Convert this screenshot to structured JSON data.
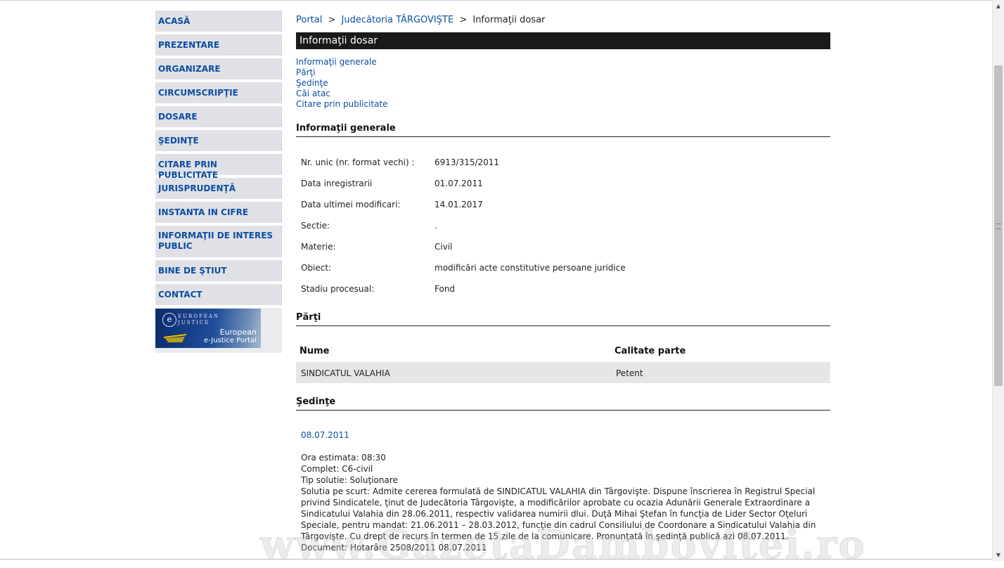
{
  "sidebar": {
    "items": [
      {
        "label": "ACASĂ"
      },
      {
        "label": "PREZENTARE"
      },
      {
        "label": "ORGANIZARE"
      },
      {
        "label": "CIRCUMSCRIPŢIE"
      },
      {
        "label": "DOSARE"
      },
      {
        "label": "ŞEDINŢE"
      },
      {
        "label": "CITARE PRIN PUBLICITATE"
      },
      {
        "label": "JURISPRUDENŢĂ"
      },
      {
        "label": "INSTANTA IN CIFRE"
      },
      {
        "label": "INFORMAŢII DE INTERES PUBLIC"
      },
      {
        "label": "BINE DE ŞTIUT"
      },
      {
        "label": "CONTACT"
      }
    ],
    "banner": {
      "logo_letter": "e",
      "line1": "EUROPEAN",
      "line2": "JUSTICE",
      "title1": "European",
      "title2": "e-Justice Portal"
    }
  },
  "breadcrumb": {
    "portal": "Portal",
    "court": "Judecătoria TÂRGOVIŞTE",
    "current": "Informaţii dosar",
    "separator": ">"
  },
  "page_title": "Informaţii dosar",
  "anchors": [
    "Informaţii generale",
    "Părţi",
    "Şedinţe",
    "Căi atac",
    "Citare prin publicitate"
  ],
  "general": {
    "heading": "Informaţii generale",
    "rows": [
      {
        "label": "Nr. unic (nr. format vechi) :",
        "value": "6913/315/2011"
      },
      {
        "label": "Data inregistrarii",
        "value": "01.07.2011"
      },
      {
        "label": "Data ultimei modificari:",
        "value": "14.01.2017"
      },
      {
        "label": "Sectie:",
        "value": "."
      },
      {
        "label": "Materie:",
        "value": "Civil"
      },
      {
        "label": "Obiect:",
        "value": "modificări acte constitutive persoane juridice"
      },
      {
        "label": "Stadiu procesual:",
        "value": "Fond"
      }
    ]
  },
  "parties": {
    "heading": "Părţi",
    "col_name": "Nume",
    "col_role": "Calitate parte",
    "rows": [
      {
        "name": "SINDICATUL VALAHIA",
        "role": "Petent"
      }
    ]
  },
  "hearings": {
    "heading": "Şedinţe",
    "date": "08.07.2011",
    "lines": [
      "Ora estimata: 08:30",
      "Complet: C6-civil",
      "Tip solutie: Soluţionare",
      "Solutia pe scurt: Admite cererea formulată de SINDICATUL VALAHIA din Târgovişte. Dispune înscrierea în Registrul Special privind Sindicatele, ţinut de Judecătoria Târgovişte, a modificărilor aprobate cu ocazia Adunării Generale Extraordinare a Sindicatului Valahia din 28.06.2011, respectiv validarea numirii dlui. Duţă Mihai Ştefan în funcţia de Lider Sector Oţeluri Speciale, pentru mandat: 21.06.2011 – 28.03.2012, funcţie din cadrul Consiliului de Coordonare a Sindicatului Valahia din Târgovişte. Cu drept de recurs în termen de 15 zile de la comunicare. Pronunţată în şedinţă publică azi 08.07.2011.",
      "Document: Hotarâre  2508/2011  08.07.2011"
    ]
  },
  "watermark": "www.GazetaDambovitei.ro"
}
